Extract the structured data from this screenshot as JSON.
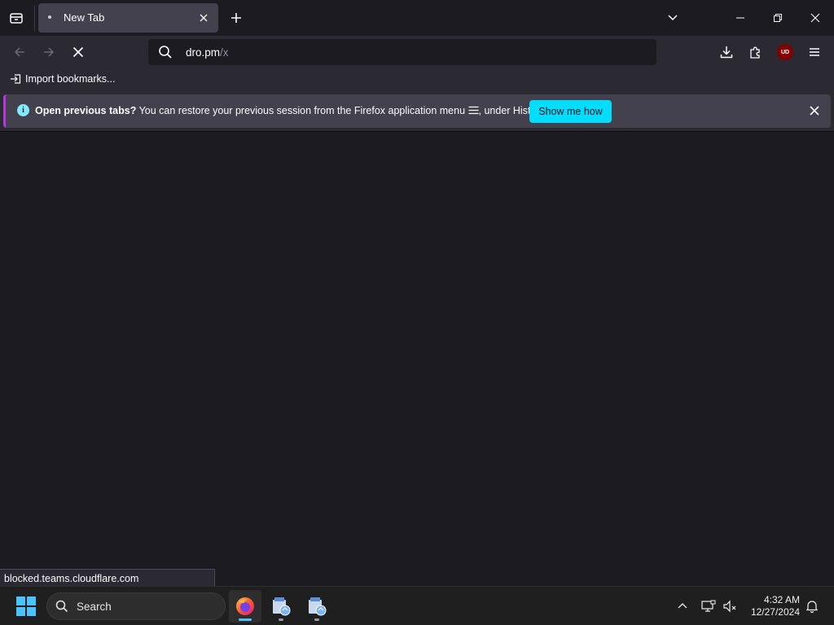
{
  "tab": {
    "title": "New Tab"
  },
  "url": {
    "host": "dro.pm",
    "path": "/x"
  },
  "bookmarks": {
    "import_label": "Import bookmarks..."
  },
  "notification": {
    "bold": "Open previous tabs?",
    "message": " You can restore your previous session from the Firefox application menu ",
    "suffix": ", under History.",
    "button": "Show me how"
  },
  "status_panel": "blocked.teams.cloudflare.com",
  "taskbar": {
    "search_label": "Search",
    "time": "4:32 AM",
    "date": "12/27/2024"
  },
  "extensions": {
    "ublock_label": "UD"
  },
  "colors": {
    "accent": "#00ddff",
    "notice_stripe": "#b833e1",
    "info": "#80ebff"
  }
}
